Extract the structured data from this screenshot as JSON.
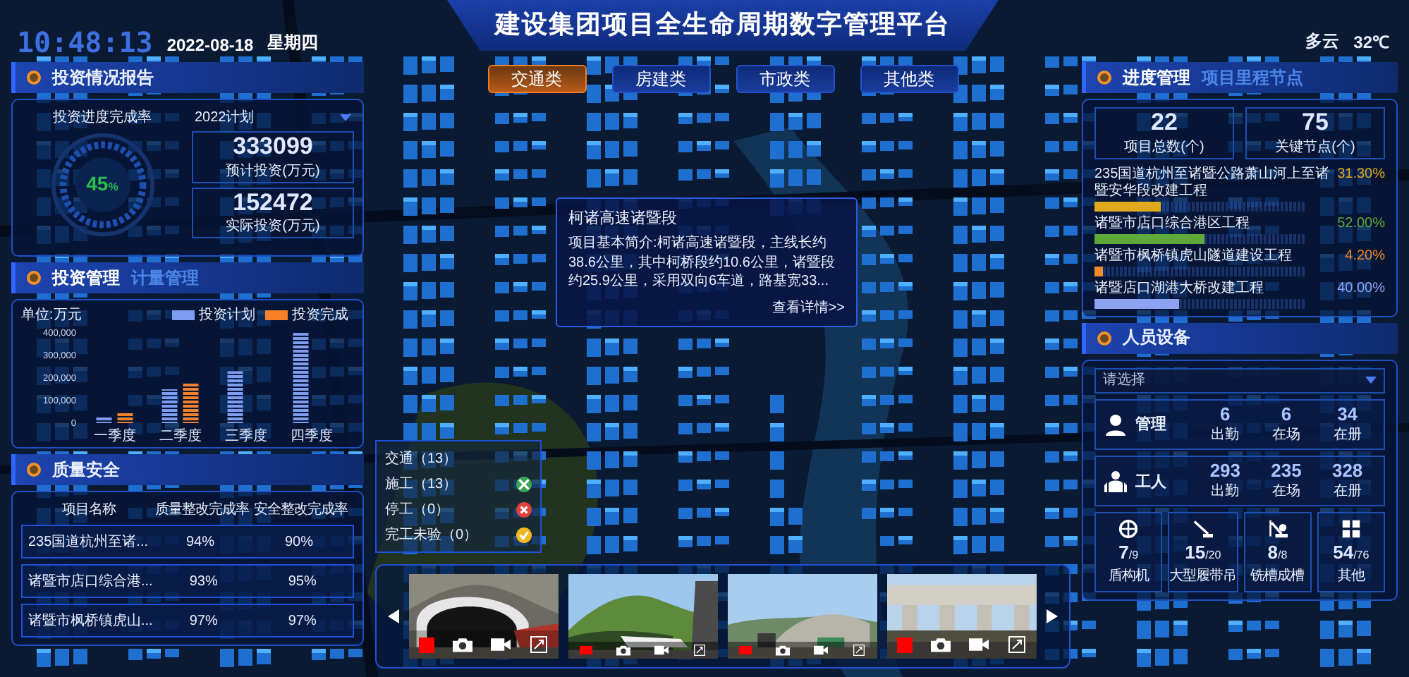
{
  "header": {
    "time": "10:48:13",
    "date": "2022-08-18",
    "weekday": "星期四",
    "title": "建设集团项目全生命周期数字管理平台",
    "weather": "多云",
    "temperature": "32℃"
  },
  "investment_report": {
    "title": "投资情况报告",
    "rate_label": "投资进度完成率",
    "year_select": "2022计划",
    "rate_value": "45",
    "rate_unit": "%",
    "stats": [
      {
        "value": "333099",
        "label": "预计投资(万元)"
      },
      {
        "value": "152472",
        "label": "实际投资(万元)"
      }
    ]
  },
  "investment_management": {
    "tabs": [
      {
        "label": "投资管理",
        "selected": true
      },
      {
        "label": "计量管理",
        "selected": false
      }
    ],
    "unit": "单位:万元",
    "chart_data": {
      "type": "bar",
      "categories": [
        "一季度",
        "二季度",
        "三季度",
        "四季度"
      ],
      "series": [
        {
          "name": "投资计划",
          "color": "#7f9cf0",
          "values": [
            30000,
            150000,
            230000,
            400000
          ]
        },
        {
          "name": "投资完成",
          "color": "#f5822a",
          "values": [
            50000,
            175000,
            0,
            0
          ]
        }
      ],
      "ylim": [
        0,
        400000
      ],
      "yticks": [
        {
          "value": 0,
          "label": "0"
        },
        {
          "value": 100000,
          "label": "100,000"
        },
        {
          "value": 200000,
          "label": "200,000"
        },
        {
          "value": 300000,
          "label": "300,000"
        },
        {
          "value": 400000,
          "label": "400,000"
        }
      ]
    }
  },
  "quality_safety": {
    "title": "质量安全",
    "columns": [
      "项目名称",
      "质量整改完成率",
      "安全整改完成率"
    ],
    "rows": [
      [
        "235国道杭州至诸...",
        "94%",
        "90%"
      ],
      [
        "诸暨市店口综合港...",
        "93%",
        "95%"
      ],
      [
        "诸暨市枫桥镇虎山...",
        "97%",
        "97%"
      ]
    ]
  },
  "category_tabs": [
    {
      "label": "交通类",
      "selected": true
    },
    {
      "label": "房建类",
      "selected": false
    },
    {
      "label": "市政类",
      "selected": false
    },
    {
      "label": "其他类",
      "selected": false
    }
  ],
  "project_popup": {
    "title": "柯诸高速诸暨段",
    "description": "项目基本简介:柯诸高速诸暨段，主线长约38.6公里，其中柯桥段约10.6公里，诸暨段约25.9公里，采用双向6车道，路基宽33...",
    "link": "查看详情>>"
  },
  "map_legend": {
    "title": "交通（13）",
    "items": [
      {
        "label": "施工（13）",
        "kind": "construction",
        "color": "#3aa757"
      },
      {
        "label": "停工（0）",
        "kind": "stopped",
        "color": "#e0413a"
      },
      {
        "label": "完工未验（0）",
        "kind": "completed",
        "color": "#f2b820"
      }
    ]
  },
  "cameras": [
    {
      "kind": "picture",
      "large_controls": true
    },
    {
      "kind": "picture",
      "large_controls": false
    },
    {
      "kind": "picture",
      "large_controls": false
    },
    {
      "kind": "picture",
      "large_controls": true
    }
  ],
  "progress": {
    "tabs": [
      {
        "label": "进度管理",
        "selected": true
      },
      {
        "label": "项目里程节点",
        "selected": false
      }
    ],
    "stats": [
      {
        "value": "22",
        "label": "项目总数(个)"
      },
      {
        "value": "75",
        "label": "关键节点(个)"
      }
    ],
    "projects": [
      {
        "name": "235国道杭州至诸暨公路萧山河上至诸暨安华段改建工程",
        "percent": "31.30%",
        "level": 0.313,
        "color": "#e0a81c"
      },
      {
        "name": "诸暨市店口综合港区工程",
        "percent": "52.00%",
        "level": 0.52,
        "color": "#5fa83a"
      },
      {
        "name": "诸暨市枫桥镇虎山隧道建设工程",
        "percent": "4.20%",
        "level": 0.042,
        "color": "#f08a2c"
      },
      {
        "name": "诸暨店口湖港大桥改建工程",
        "percent": "40.00%",
        "level": 0.4,
        "color": "#8da2f0"
      }
    ]
  },
  "personnel": {
    "title": "人员设备",
    "placeholder": "请选择",
    "groups": [
      {
        "kind": "manager",
        "label": "管理",
        "stats": [
          {
            "value": "6",
            "label": "出勤"
          },
          {
            "value": "6",
            "label": "在场"
          },
          {
            "value": "34",
            "label": "在册"
          }
        ]
      },
      {
        "kind": "worker",
        "label": "工人",
        "stats": [
          {
            "value": "293",
            "label": "出勤"
          },
          {
            "value": "235",
            "label": "在场"
          },
          {
            "value": "328",
            "label": "在册"
          }
        ]
      }
    ],
    "equipment": [
      {
        "kind": "shield",
        "count": "7",
        "total": "/9",
        "label": "盾构机"
      },
      {
        "kind": "crane",
        "count": "15",
        "total": "/20",
        "label": "大型履带吊"
      },
      {
        "kind": "rig",
        "count": "8",
        "total": "/8",
        "label": "铣槽成槽"
      },
      {
        "kind": "other",
        "count": "54",
        "total": "/76",
        "label": "其他"
      }
    ]
  }
}
